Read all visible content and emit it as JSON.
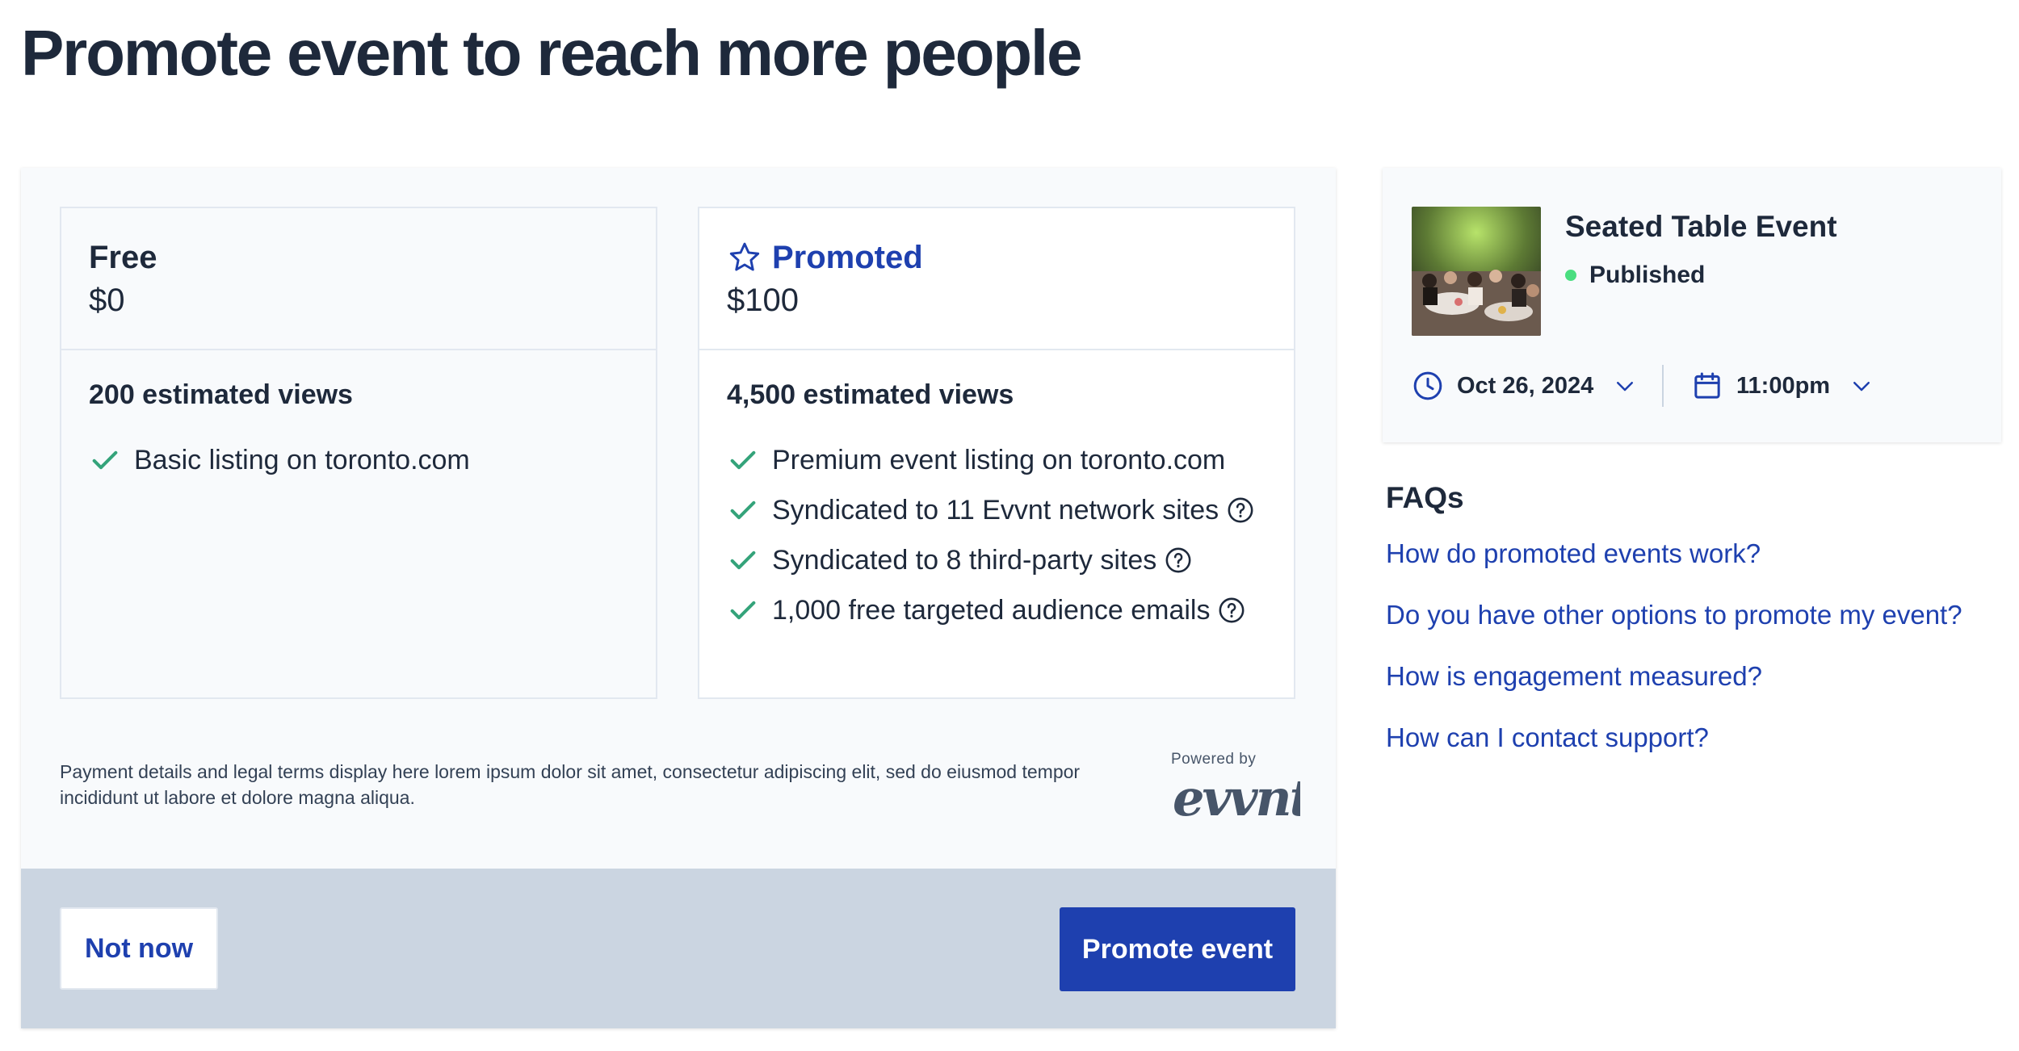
{
  "page": {
    "title": "Promote event to reach more people"
  },
  "plans": {
    "free": {
      "name": "Free",
      "price": "$0",
      "views": "200 estimated views",
      "features": [
        {
          "label": "Basic listing on toronto.com",
          "help": false
        }
      ]
    },
    "promoted": {
      "name": "Promoted",
      "icon": "star-outline-icon",
      "price": "$100",
      "views": "4,500 estimated views",
      "features": [
        {
          "label": "Premium event listing on toronto.com",
          "help": false
        },
        {
          "label": "Syndicated to 11 Evvnt network sites",
          "help": true
        },
        {
          "label": "Syndicated to 8 third-party sites",
          "help": true
        },
        {
          "label": "1,000 free targeted audience emails",
          "help": true
        }
      ]
    }
  },
  "legal": {
    "text": "Payment details and legal terms display here lorem ipsum dolor sit amet, consectetur adipiscing elit, sed do eiusmod tempor incididunt ut labore et dolore magna aliqua."
  },
  "powered_by": {
    "label": "Powered by",
    "brand": "evvnt"
  },
  "actions": {
    "secondary_label": "Not now",
    "primary_label": "Promote event"
  },
  "event": {
    "title": "Seated Table Event",
    "status": "Published",
    "date": "Oct 26, 2024",
    "time": "11:00pm"
  },
  "faqs": {
    "title": "FAQs",
    "items": [
      "How do promoted events work?",
      "Do you have other options to promote my event?",
      "How is engagement measured?",
      "How can I contact support?"
    ]
  },
  "colors": {
    "brand": "#1e40af",
    "check": "#34a37a",
    "status_published": "#4ade80",
    "footer_bar": "#cbd5e1"
  }
}
